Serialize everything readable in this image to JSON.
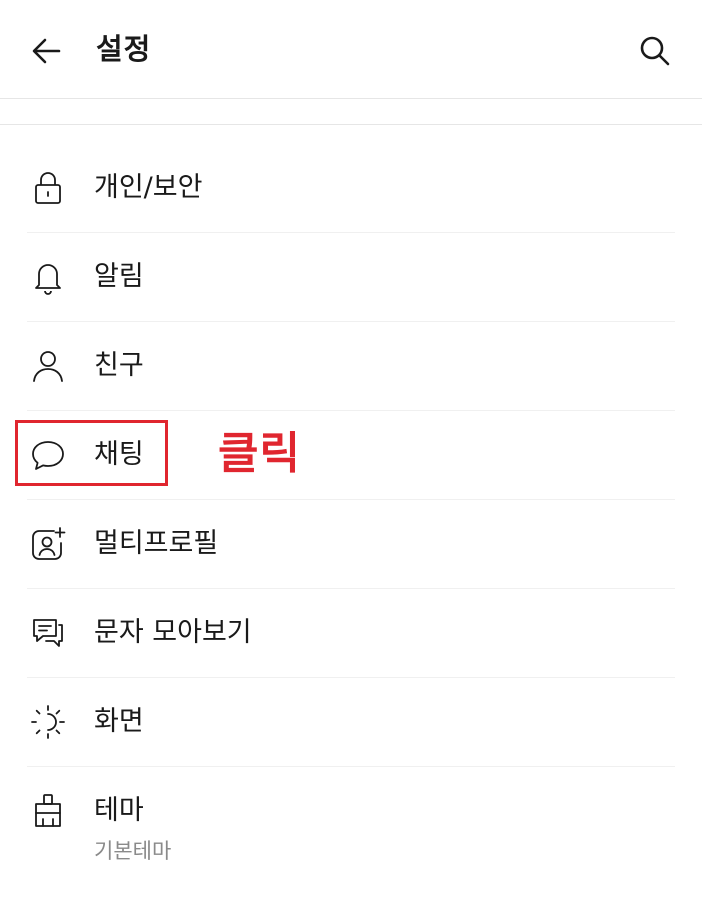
{
  "header": {
    "title": "설정",
    "back_icon": "arrow-left-icon",
    "search_icon": "search-icon"
  },
  "menu": {
    "items": [
      {
        "label": "개인/보안",
        "icon": "lock-icon"
      },
      {
        "label": "알림",
        "icon": "bell-icon"
      },
      {
        "label": "친구",
        "icon": "person-icon"
      },
      {
        "label": "채팅",
        "icon": "chat-bubble-icon"
      },
      {
        "label": "멀티프로필",
        "icon": "profile-add-icon"
      },
      {
        "label": "문자 모아보기",
        "icon": "messages-icon"
      },
      {
        "label": "화면",
        "icon": "brightness-icon"
      },
      {
        "label": "테마",
        "icon": "paint-brush-icon",
        "sublabel": "기본테마"
      }
    ]
  },
  "annotation": {
    "text": "클릭",
    "color": "#e0262f"
  }
}
